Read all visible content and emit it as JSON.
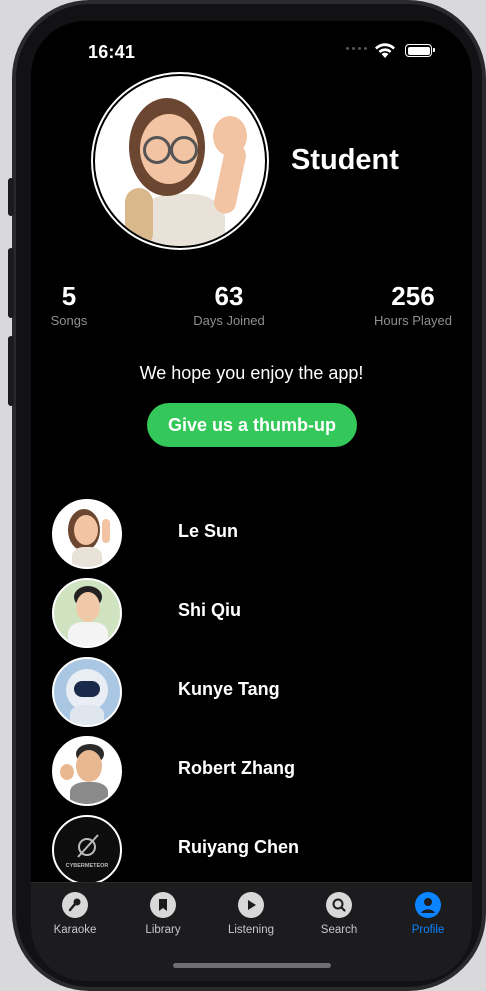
{
  "status_bar": {
    "time": "16:41"
  },
  "profile": {
    "name": "Student"
  },
  "stats": [
    {
      "value": "5",
      "label": "Songs"
    },
    {
      "value": "63",
      "label": "Days Joined"
    },
    {
      "value": "256",
      "label": "Hours Played"
    }
  ],
  "message": "We hope you enjoy the app!",
  "thumb_button": "Give us a thumb-up",
  "friends": [
    {
      "name": "Le Sun"
    },
    {
      "name": "Shi Qiu"
    },
    {
      "name": "Kunye Tang"
    },
    {
      "name": "Robert Zhang"
    },
    {
      "name": "Ruiyang Chen",
      "logo_text": "CYBERMETEOR"
    }
  ],
  "tabs": [
    {
      "label": "Karaoke",
      "icon": "microphone-icon"
    },
    {
      "label": "Library",
      "icon": "bookmark-icon"
    },
    {
      "label": "Listening",
      "icon": "play-icon"
    },
    {
      "label": "Search",
      "icon": "search-icon"
    },
    {
      "label": "Profile",
      "icon": "person-icon",
      "active": true
    }
  ],
  "colors": {
    "accent": "#34c759",
    "tab_active": "#0a84ff",
    "background": "#000000"
  }
}
